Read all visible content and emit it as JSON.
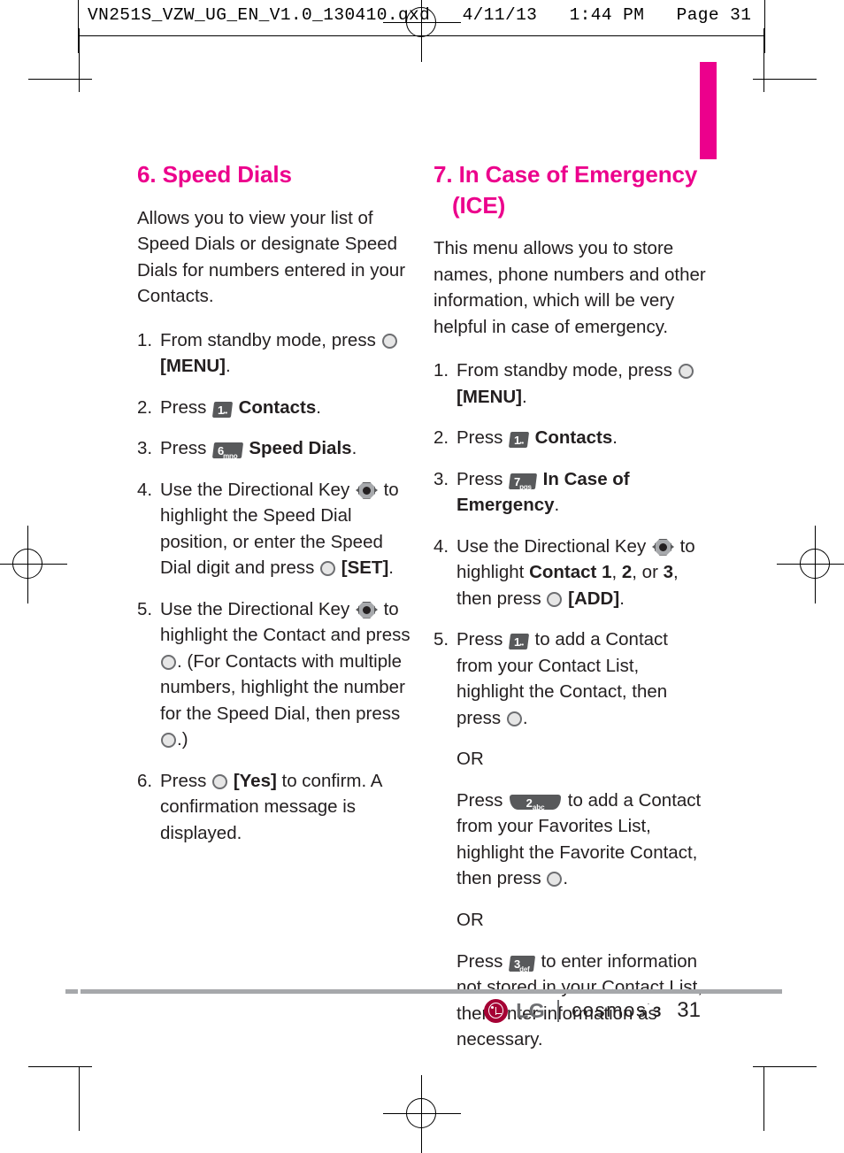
{
  "print_slug": "VN251S_VZW_UG_EN_V1.0_130410.qxd   4/11/13   1:44 PM   Page 31",
  "colors": {
    "accent_magenta": "#ec008c",
    "lg_red": "#a50034",
    "body_text": "#231f20",
    "rule_gray": "#a6a8ab"
  },
  "left_column": {
    "title": "6. Speed Dials",
    "intro": "Allows you to view your list of Speed Dials or designate Speed Dials for numbers entered in your Contacts.",
    "steps": [
      {
        "num": "1.",
        "parts": [
          {
            "t": "text",
            "v": "From standby mode, press "
          },
          {
            "t": "okkey"
          },
          {
            "t": "text",
            "v": " "
          },
          {
            "t": "bold",
            "v": "[MENU]"
          },
          {
            "t": "text",
            "v": "."
          }
        ]
      },
      {
        "num": "2.",
        "parts": [
          {
            "t": "text",
            "v": "Press  "
          },
          {
            "t": "key",
            "style": "slab",
            "digit": "1",
            "letters": "☰"
          },
          {
            "t": "text",
            "v": "  "
          },
          {
            "t": "bold",
            "v": "Contacts"
          },
          {
            "t": "text",
            "v": "."
          }
        ]
      },
      {
        "num": "3.",
        "parts": [
          {
            "t": "text",
            "v": "Press  "
          },
          {
            "t": "key",
            "style": "slab",
            "digit": "6",
            "letters": "mno"
          },
          {
            "t": "text",
            "v": "  "
          },
          {
            "t": "bold",
            "v": "Speed Dials"
          },
          {
            "t": "text",
            "v": "."
          }
        ]
      },
      {
        "num": "4.",
        "parts": [
          {
            "t": "text",
            "v": "Use the Directional Key "
          },
          {
            "t": "dirkey"
          },
          {
            "t": "text",
            "v": " to highlight the Speed Dial position, or enter the Speed Dial digit and press "
          },
          {
            "t": "okkey"
          },
          {
            "t": "text",
            "v": " "
          },
          {
            "t": "bold",
            "v": "[SET]"
          },
          {
            "t": "text",
            "v": "."
          }
        ]
      },
      {
        "num": "5.",
        "parts": [
          {
            "t": "text",
            "v": "Use the Directional Key "
          },
          {
            "t": "dirkey"
          },
          {
            "t": "text",
            "v": " to highlight the Contact and press "
          },
          {
            "t": "okkey"
          },
          {
            "t": "text",
            "v": ". (For Contacts with multiple numbers, highlight the number for the Speed Dial, then press "
          },
          {
            "t": "okkey"
          },
          {
            "t": "text",
            "v": ".)"
          }
        ]
      },
      {
        "num": "6.",
        "parts": [
          {
            "t": "text",
            "v": "Press "
          },
          {
            "t": "okkey"
          },
          {
            "t": "text",
            "v": " "
          },
          {
            "t": "bold",
            "v": "[Yes]"
          },
          {
            "t": "text",
            "v": " to confirm. A confirmation message is displayed."
          }
        ]
      }
    ]
  },
  "right_column": {
    "title_line1": "7. In Case of Emergency",
    "title_line2": "(ICE)",
    "intro": "This menu allows you to store names, phone numbers and other information, which will be very helpful in case of emergency.",
    "steps": [
      {
        "num": "1.",
        "parts": [
          {
            "t": "text",
            "v": "From standby mode, press "
          },
          {
            "t": "okkey"
          },
          {
            "t": "text",
            "v": " "
          },
          {
            "t": "bold",
            "v": "[MENU]"
          },
          {
            "t": "text",
            "v": "."
          }
        ]
      },
      {
        "num": "2.",
        "parts": [
          {
            "t": "text",
            "v": "Press  "
          },
          {
            "t": "key",
            "style": "slab",
            "digit": "1",
            "letters": "☰"
          },
          {
            "t": "text",
            "v": "  "
          },
          {
            "t": "bold",
            "v": "Contacts"
          },
          {
            "t": "text",
            "v": "."
          }
        ]
      },
      {
        "num": "3.",
        "parts": [
          {
            "t": "text",
            "v": "Press  "
          },
          {
            "t": "key",
            "style": "slab",
            "digit": "7",
            "letters": "pqs"
          },
          {
            "t": "text",
            "v": "  "
          },
          {
            "t": "bold",
            "v": "In Case of Emergency"
          },
          {
            "t": "text",
            "v": "."
          }
        ]
      },
      {
        "num": "4.",
        "parts": [
          {
            "t": "text",
            "v": "Use the Directional Key "
          },
          {
            "t": "dirkey"
          },
          {
            "t": "text",
            "v": " to highlight "
          },
          {
            "t": "bold",
            "v": "Contact 1"
          },
          {
            "t": "text",
            "v": ", "
          },
          {
            "t": "bold",
            "v": "2"
          },
          {
            "t": "text",
            "v": ", or "
          },
          {
            "t": "bold",
            "v": "3"
          },
          {
            "t": "text",
            "v": ", then press "
          },
          {
            "t": "okkey"
          },
          {
            "t": "text",
            "v": " "
          },
          {
            "t": "bold",
            "v": "[ADD]"
          },
          {
            "t": "text",
            "v": "."
          }
        ]
      },
      {
        "num": "5.",
        "parts": [
          {
            "t": "text",
            "v": "Press  "
          },
          {
            "t": "key",
            "style": "slab",
            "digit": "1",
            "letters": "☰"
          },
          {
            "t": "text",
            "v": "  to add a Contact from your Contact List, highlight the Contact, then press "
          },
          {
            "t": "okkey"
          },
          {
            "t": "text",
            "v": "."
          }
        ]
      }
    ],
    "alternatives": [
      {
        "or_label": "OR",
        "parts": [
          {
            "t": "text",
            "v": "Press "
          },
          {
            "t": "key",
            "style": "curve",
            "digit": "2",
            "letters": "abc"
          },
          {
            "t": "text",
            "v": " to add a Contact from your Favorites List, highlight the Favorite Contact, then press "
          },
          {
            "t": "okkey"
          },
          {
            "t": "text",
            "v": "."
          }
        ]
      },
      {
        "or_label": "OR",
        "parts": [
          {
            "t": "text",
            "v": "Press "
          },
          {
            "t": "key",
            "style": "slab",
            "digit": "3",
            "letters": "def"
          },
          {
            "t": "text",
            "v": " to enter information not stored in your Contact List, then enter information as necessary."
          }
        ]
      }
    ]
  },
  "footer": {
    "brand": "LG",
    "separator": "|",
    "product": "cosmos",
    "product_trademark": "˙",
    "product_version": "3",
    "page_number": "31"
  }
}
